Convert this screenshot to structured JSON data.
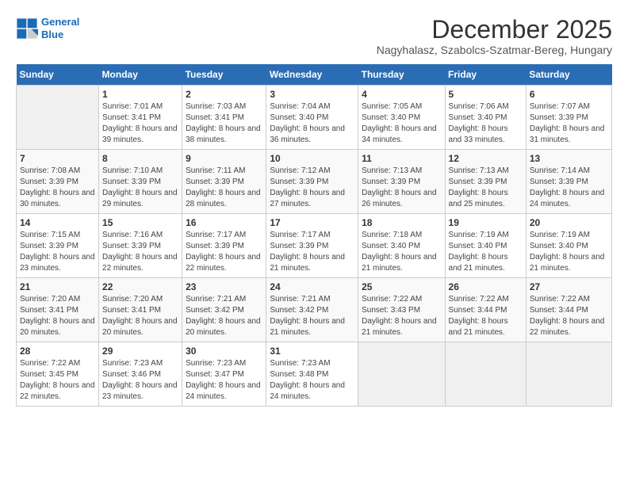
{
  "logo": {
    "line1": "General",
    "line2": "Blue"
  },
  "title": "December 2025",
  "subtitle": "Nagyhalasz, Szabolcs-Szatmar-Bereg, Hungary",
  "weekdays": [
    "Sunday",
    "Monday",
    "Tuesday",
    "Wednesday",
    "Thursday",
    "Friday",
    "Saturday"
  ],
  "weeks": [
    [
      {
        "day": "",
        "sunrise": "",
        "sunset": "",
        "daylight": ""
      },
      {
        "day": "1",
        "sunrise": "Sunrise: 7:01 AM",
        "sunset": "Sunset: 3:41 PM",
        "daylight": "Daylight: 8 hours and 39 minutes."
      },
      {
        "day": "2",
        "sunrise": "Sunrise: 7:03 AM",
        "sunset": "Sunset: 3:41 PM",
        "daylight": "Daylight: 8 hours and 38 minutes."
      },
      {
        "day": "3",
        "sunrise": "Sunrise: 7:04 AM",
        "sunset": "Sunset: 3:40 PM",
        "daylight": "Daylight: 8 hours and 36 minutes."
      },
      {
        "day": "4",
        "sunrise": "Sunrise: 7:05 AM",
        "sunset": "Sunset: 3:40 PM",
        "daylight": "Daylight: 8 hours and 34 minutes."
      },
      {
        "day": "5",
        "sunrise": "Sunrise: 7:06 AM",
        "sunset": "Sunset: 3:40 PM",
        "daylight": "Daylight: 8 hours and 33 minutes."
      },
      {
        "day": "6",
        "sunrise": "Sunrise: 7:07 AM",
        "sunset": "Sunset: 3:39 PM",
        "daylight": "Daylight: 8 hours and 31 minutes."
      }
    ],
    [
      {
        "day": "7",
        "sunrise": "Sunrise: 7:08 AM",
        "sunset": "Sunset: 3:39 PM",
        "daylight": "Daylight: 8 hours and 30 minutes."
      },
      {
        "day": "8",
        "sunrise": "Sunrise: 7:10 AM",
        "sunset": "Sunset: 3:39 PM",
        "daylight": "Daylight: 8 hours and 29 minutes."
      },
      {
        "day": "9",
        "sunrise": "Sunrise: 7:11 AM",
        "sunset": "Sunset: 3:39 PM",
        "daylight": "Daylight: 8 hours and 28 minutes."
      },
      {
        "day": "10",
        "sunrise": "Sunrise: 7:12 AM",
        "sunset": "Sunset: 3:39 PM",
        "daylight": "Daylight: 8 hours and 27 minutes."
      },
      {
        "day": "11",
        "sunrise": "Sunrise: 7:13 AM",
        "sunset": "Sunset: 3:39 PM",
        "daylight": "Daylight: 8 hours and 26 minutes."
      },
      {
        "day": "12",
        "sunrise": "Sunrise: 7:13 AM",
        "sunset": "Sunset: 3:39 PM",
        "daylight": "Daylight: 8 hours and 25 minutes."
      },
      {
        "day": "13",
        "sunrise": "Sunrise: 7:14 AM",
        "sunset": "Sunset: 3:39 PM",
        "daylight": "Daylight: 8 hours and 24 minutes."
      }
    ],
    [
      {
        "day": "14",
        "sunrise": "Sunrise: 7:15 AM",
        "sunset": "Sunset: 3:39 PM",
        "daylight": "Daylight: 8 hours and 23 minutes."
      },
      {
        "day": "15",
        "sunrise": "Sunrise: 7:16 AM",
        "sunset": "Sunset: 3:39 PM",
        "daylight": "Daylight: 8 hours and 22 minutes."
      },
      {
        "day": "16",
        "sunrise": "Sunrise: 7:17 AM",
        "sunset": "Sunset: 3:39 PM",
        "daylight": "Daylight: 8 hours and 22 minutes."
      },
      {
        "day": "17",
        "sunrise": "Sunrise: 7:17 AM",
        "sunset": "Sunset: 3:39 PM",
        "daylight": "Daylight: 8 hours and 21 minutes."
      },
      {
        "day": "18",
        "sunrise": "Sunrise: 7:18 AM",
        "sunset": "Sunset: 3:40 PM",
        "daylight": "Daylight: 8 hours and 21 minutes."
      },
      {
        "day": "19",
        "sunrise": "Sunrise: 7:19 AM",
        "sunset": "Sunset: 3:40 PM",
        "daylight": "Daylight: 8 hours and 21 minutes."
      },
      {
        "day": "20",
        "sunrise": "Sunrise: 7:19 AM",
        "sunset": "Sunset: 3:40 PM",
        "daylight": "Daylight: 8 hours and 21 minutes."
      }
    ],
    [
      {
        "day": "21",
        "sunrise": "Sunrise: 7:20 AM",
        "sunset": "Sunset: 3:41 PM",
        "daylight": "Daylight: 8 hours and 20 minutes."
      },
      {
        "day": "22",
        "sunrise": "Sunrise: 7:20 AM",
        "sunset": "Sunset: 3:41 PM",
        "daylight": "Daylight: 8 hours and 20 minutes."
      },
      {
        "day": "23",
        "sunrise": "Sunrise: 7:21 AM",
        "sunset": "Sunset: 3:42 PM",
        "daylight": "Daylight: 8 hours and 20 minutes."
      },
      {
        "day": "24",
        "sunrise": "Sunrise: 7:21 AM",
        "sunset": "Sunset: 3:42 PM",
        "daylight": "Daylight: 8 hours and 21 minutes."
      },
      {
        "day": "25",
        "sunrise": "Sunrise: 7:22 AM",
        "sunset": "Sunset: 3:43 PM",
        "daylight": "Daylight: 8 hours and 21 minutes."
      },
      {
        "day": "26",
        "sunrise": "Sunrise: 7:22 AM",
        "sunset": "Sunset: 3:44 PM",
        "daylight": "Daylight: 8 hours and 21 minutes."
      },
      {
        "day": "27",
        "sunrise": "Sunrise: 7:22 AM",
        "sunset": "Sunset: 3:44 PM",
        "daylight": "Daylight: 8 hours and 22 minutes."
      }
    ],
    [
      {
        "day": "28",
        "sunrise": "Sunrise: 7:22 AM",
        "sunset": "Sunset: 3:45 PM",
        "daylight": "Daylight: 8 hours and 22 minutes."
      },
      {
        "day": "29",
        "sunrise": "Sunrise: 7:23 AM",
        "sunset": "Sunset: 3:46 PM",
        "daylight": "Daylight: 8 hours and 23 minutes."
      },
      {
        "day": "30",
        "sunrise": "Sunrise: 7:23 AM",
        "sunset": "Sunset: 3:47 PM",
        "daylight": "Daylight: 8 hours and 24 minutes."
      },
      {
        "day": "31",
        "sunrise": "Sunrise: 7:23 AM",
        "sunset": "Sunset: 3:48 PM",
        "daylight": "Daylight: 8 hours and 24 minutes."
      },
      {
        "day": "",
        "sunrise": "",
        "sunset": "",
        "daylight": ""
      },
      {
        "day": "",
        "sunrise": "",
        "sunset": "",
        "daylight": ""
      },
      {
        "day": "",
        "sunrise": "",
        "sunset": "",
        "daylight": ""
      }
    ]
  ]
}
